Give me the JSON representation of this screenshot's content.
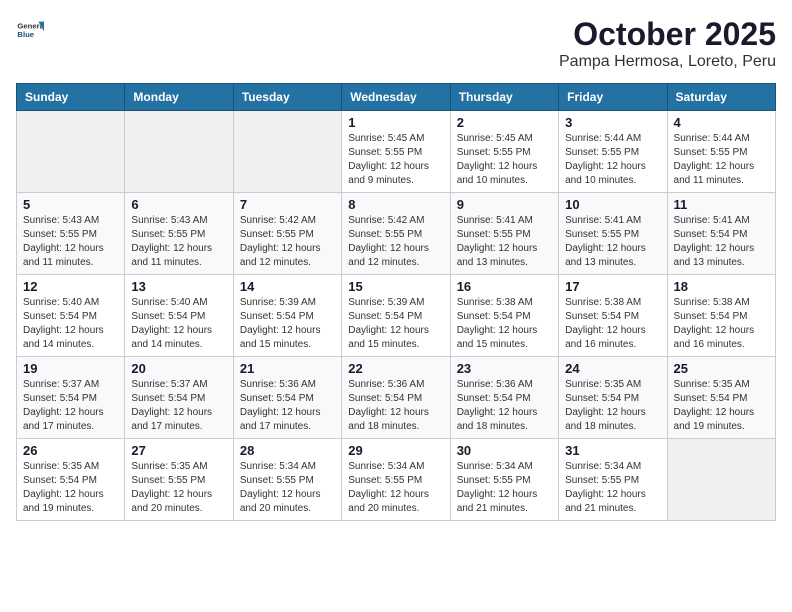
{
  "header": {
    "logo_general": "General",
    "logo_blue": "Blue",
    "title": "October 2025",
    "subtitle": "Pampa Hermosa, Loreto, Peru"
  },
  "days_of_week": [
    "Sunday",
    "Monday",
    "Tuesday",
    "Wednesday",
    "Thursday",
    "Friday",
    "Saturday"
  ],
  "weeks": [
    [
      {
        "date": "",
        "info": ""
      },
      {
        "date": "",
        "info": ""
      },
      {
        "date": "",
        "info": ""
      },
      {
        "date": "1",
        "info": "Sunrise: 5:45 AM\nSunset: 5:55 PM\nDaylight: 12 hours\nand 9 minutes."
      },
      {
        "date": "2",
        "info": "Sunrise: 5:45 AM\nSunset: 5:55 PM\nDaylight: 12 hours\nand 10 minutes."
      },
      {
        "date": "3",
        "info": "Sunrise: 5:44 AM\nSunset: 5:55 PM\nDaylight: 12 hours\nand 10 minutes."
      },
      {
        "date": "4",
        "info": "Sunrise: 5:44 AM\nSunset: 5:55 PM\nDaylight: 12 hours\nand 11 minutes."
      }
    ],
    [
      {
        "date": "5",
        "info": "Sunrise: 5:43 AM\nSunset: 5:55 PM\nDaylight: 12 hours\nand 11 minutes."
      },
      {
        "date": "6",
        "info": "Sunrise: 5:43 AM\nSunset: 5:55 PM\nDaylight: 12 hours\nand 11 minutes."
      },
      {
        "date": "7",
        "info": "Sunrise: 5:42 AM\nSunset: 5:55 PM\nDaylight: 12 hours\nand 12 minutes."
      },
      {
        "date": "8",
        "info": "Sunrise: 5:42 AM\nSunset: 5:55 PM\nDaylight: 12 hours\nand 12 minutes."
      },
      {
        "date": "9",
        "info": "Sunrise: 5:41 AM\nSunset: 5:55 PM\nDaylight: 12 hours\nand 13 minutes."
      },
      {
        "date": "10",
        "info": "Sunrise: 5:41 AM\nSunset: 5:55 PM\nDaylight: 12 hours\nand 13 minutes."
      },
      {
        "date": "11",
        "info": "Sunrise: 5:41 AM\nSunset: 5:54 PM\nDaylight: 12 hours\nand 13 minutes."
      }
    ],
    [
      {
        "date": "12",
        "info": "Sunrise: 5:40 AM\nSunset: 5:54 PM\nDaylight: 12 hours\nand 14 minutes."
      },
      {
        "date": "13",
        "info": "Sunrise: 5:40 AM\nSunset: 5:54 PM\nDaylight: 12 hours\nand 14 minutes."
      },
      {
        "date": "14",
        "info": "Sunrise: 5:39 AM\nSunset: 5:54 PM\nDaylight: 12 hours\nand 15 minutes."
      },
      {
        "date": "15",
        "info": "Sunrise: 5:39 AM\nSunset: 5:54 PM\nDaylight: 12 hours\nand 15 minutes."
      },
      {
        "date": "16",
        "info": "Sunrise: 5:38 AM\nSunset: 5:54 PM\nDaylight: 12 hours\nand 15 minutes."
      },
      {
        "date": "17",
        "info": "Sunrise: 5:38 AM\nSunset: 5:54 PM\nDaylight: 12 hours\nand 16 minutes."
      },
      {
        "date": "18",
        "info": "Sunrise: 5:38 AM\nSunset: 5:54 PM\nDaylight: 12 hours\nand 16 minutes."
      }
    ],
    [
      {
        "date": "19",
        "info": "Sunrise: 5:37 AM\nSunset: 5:54 PM\nDaylight: 12 hours\nand 17 minutes."
      },
      {
        "date": "20",
        "info": "Sunrise: 5:37 AM\nSunset: 5:54 PM\nDaylight: 12 hours\nand 17 minutes."
      },
      {
        "date": "21",
        "info": "Sunrise: 5:36 AM\nSunset: 5:54 PM\nDaylight: 12 hours\nand 17 minutes."
      },
      {
        "date": "22",
        "info": "Sunrise: 5:36 AM\nSunset: 5:54 PM\nDaylight: 12 hours\nand 18 minutes."
      },
      {
        "date": "23",
        "info": "Sunrise: 5:36 AM\nSunset: 5:54 PM\nDaylight: 12 hours\nand 18 minutes."
      },
      {
        "date": "24",
        "info": "Sunrise: 5:35 AM\nSunset: 5:54 PM\nDaylight: 12 hours\nand 18 minutes."
      },
      {
        "date": "25",
        "info": "Sunrise: 5:35 AM\nSunset: 5:54 PM\nDaylight: 12 hours\nand 19 minutes."
      }
    ],
    [
      {
        "date": "26",
        "info": "Sunrise: 5:35 AM\nSunset: 5:54 PM\nDaylight: 12 hours\nand 19 minutes."
      },
      {
        "date": "27",
        "info": "Sunrise: 5:35 AM\nSunset: 5:55 PM\nDaylight: 12 hours\nand 20 minutes."
      },
      {
        "date": "28",
        "info": "Sunrise: 5:34 AM\nSunset: 5:55 PM\nDaylight: 12 hours\nand 20 minutes."
      },
      {
        "date": "29",
        "info": "Sunrise: 5:34 AM\nSunset: 5:55 PM\nDaylight: 12 hours\nand 20 minutes."
      },
      {
        "date": "30",
        "info": "Sunrise: 5:34 AM\nSunset: 5:55 PM\nDaylight: 12 hours\nand 21 minutes."
      },
      {
        "date": "31",
        "info": "Sunrise: 5:34 AM\nSunset: 5:55 PM\nDaylight: 12 hours\nand 21 minutes."
      },
      {
        "date": "",
        "info": ""
      }
    ]
  ]
}
